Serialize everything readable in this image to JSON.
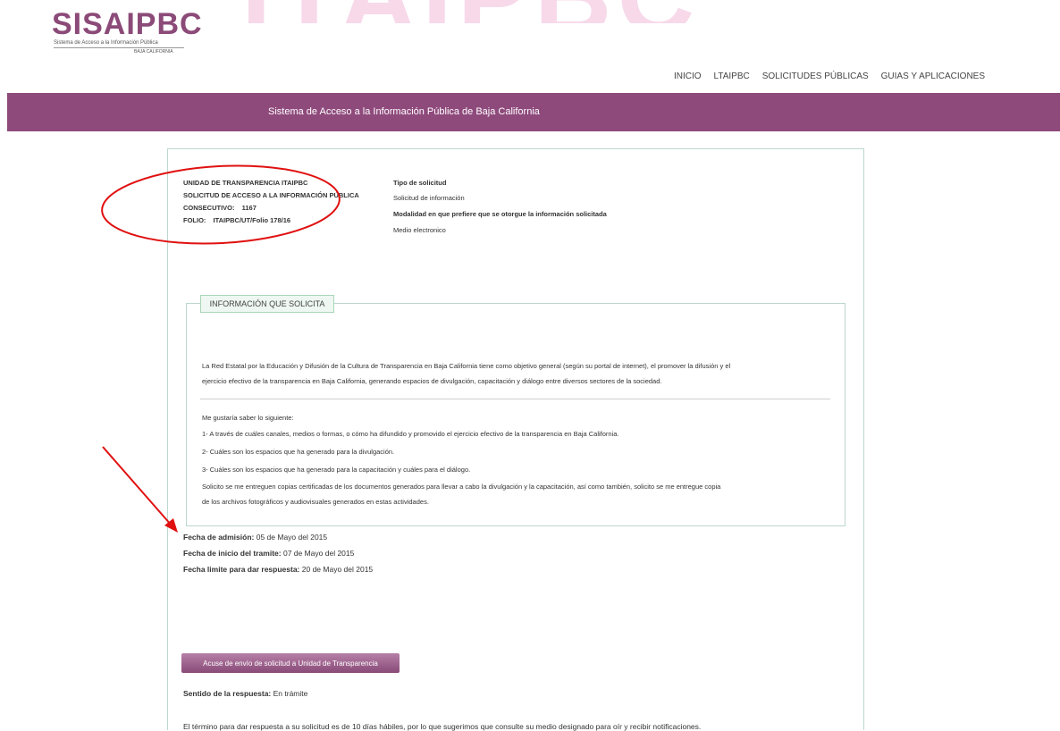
{
  "logo": {
    "main": "SISAIPBC",
    "sub1": "Sistema de Acceso a la Información Pública",
    "sub2": "BAJA CALIFORNIA"
  },
  "nav": [
    "INICIO",
    "LTAIPBC",
    "SOLICITUDES PÚBLICAS",
    "GUIAS Y APLICACIONES"
  ],
  "banner": {
    "title": "Sistema de Acceso a la Información Pública de Baja California"
  },
  "request": {
    "unit": "UNIDAD DE TRANSPARENCIA ITAIPBC",
    "title": "SOLICITUD DE ACCESO A LA INFORMACIÓN PÚBLICA",
    "consecutivo_label": "CONSECUTIVO:",
    "consecutivo_value": "1167",
    "folio_label": "FOLIO:",
    "folio_value": "ITAIPBC/UT/Folio 178/16",
    "tipo_label": "Tipo de solicitud",
    "tipo_value": "Solicitud de información",
    "modalidad_label": "Modalidad en que prefiere que se otorgue la información solicitada",
    "modalidad_value": "Medio electronico"
  },
  "info": {
    "legend": "INFORMACIÓN QUE SOLICITA",
    "p1_l1": "La Red Estatal por la Educación y Difusión de la Cultura de Transparencia en Baja California tiene como objetivo general (según su portal de internet), el promover la difusión y el",
    "p1_l2": "ejercicio efectivo de la transparencia en Baja California, generando espacios de divulgación, capacitación y diálogo entre diversos sectores de la sociedad.",
    "l_intro": "Me gustaría saber lo siguiente:",
    "l_1": "1- A través de cuáles canales, medios o formas, o cómo ha difundido y promovido el ejercicio efectivo de la transparencia en Baja California.",
    "l_2": "2- Cuáles son los espacios que ha generado para la divulgación.",
    "l_3": "3- Cuáles son los espacios que ha generado para la capacitación y cuáles para el diálogo.",
    "l_4a": "Solicito se me entreguen copias certificadas de los documentos generados para llevar a cabo la divulgación y la capacitación, así como también, solicito se me entregue copia",
    "l_4b": "de los archivos fotográficos y audiovisuales generados en estas actividades."
  },
  "dates": {
    "admision_label": "Fecha de admisión:",
    "admision_value": "05 de Mayo del 2015",
    "inicio_label": "Fecha de inicio del tramite:",
    "inicio_value": "07 de Mayo del 2015",
    "limite_label": "Fecha limite para dar respuesta:",
    "limite_value": "20 de Mayo del 2015"
  },
  "button": {
    "label": "Acuse de envío de solicitud a Unidad de Transparencia"
  },
  "response": {
    "sentido_label": "Sentido de la respuesta:",
    "sentido_value": "En trámite",
    "termino": "El término para dar respuesta a su solicitud es de 10 días hábiles, por lo que sugerimos que consulte su medio designado para oír y recibir notificaciones."
  },
  "colors": {
    "brand_purple": "#8f4a7c",
    "annotation_red": "#e01010",
    "legend_green": "#a9d6b9"
  }
}
